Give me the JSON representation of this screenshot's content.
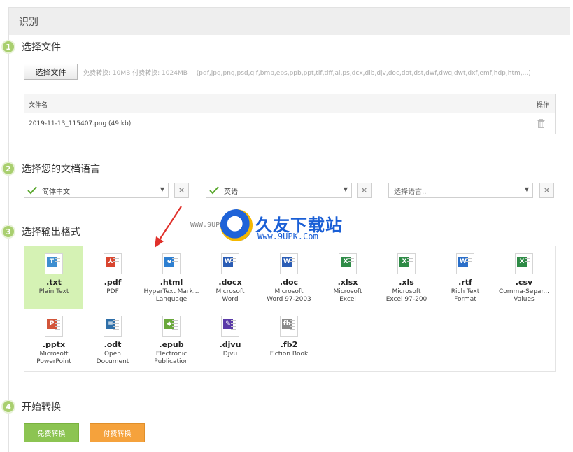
{
  "panel": {
    "title": "识别"
  },
  "steps": [
    {
      "num": "1",
      "title": "选择文件"
    },
    {
      "num": "2",
      "title": "选择您的文档语言"
    },
    {
      "num": "3",
      "title": "选择输出格式"
    },
    {
      "num": "4",
      "title": "开始转换"
    }
  ],
  "file": {
    "button_label": "选择文件",
    "limits": "免费转换: 10MB  付费转换: 1024MB",
    "formats": "(pdf,jpg,png,psd,gif,bmp,eps,ppb,ppt,tif,tiff,ai,ps,dcx,dib,djv,doc,dot,dst,dwf,dwg,dwt,dxf,emf,hdp,htm,...)",
    "table": {
      "col_name": "文件名",
      "col_action": "操作",
      "rows": [
        {
          "name": "2019-11-13_115407.png (49 kb)"
        }
      ]
    }
  },
  "languages": [
    {
      "value": "简体中文",
      "checked": true
    },
    {
      "value": "英语",
      "checked": true
    },
    {
      "value": "选择语言..",
      "checked": false
    }
  ],
  "formats": [
    {
      "ext": ".txt",
      "desc1": "Plain Text",
      "desc2": "",
      "badge": "T",
      "color": "#3e8ed0",
      "icon": "txt-file-icon",
      "selected": true
    },
    {
      "ext": ".pdf",
      "desc1": "PDF",
      "desc2": "",
      "badge": "⅄",
      "color": "#d9452f",
      "icon": "pdf-file-icon",
      "selected": false
    },
    {
      "ext": ".html",
      "desc1": "HyperText Mark...",
      "desc2": "Language",
      "badge": "e",
      "color": "#2d7fd1",
      "icon": "html-file-icon",
      "selected": false
    },
    {
      "ext": ".docx",
      "desc1": "Microsoft",
      "desc2": "Word",
      "badge": "W",
      "color": "#2b5db5",
      "icon": "docx-file-icon",
      "selected": false
    },
    {
      "ext": ".doc",
      "desc1": "Microsoft",
      "desc2": "Word 97-2003",
      "badge": "W",
      "color": "#2b5db5",
      "icon": "doc-file-icon",
      "selected": false
    },
    {
      "ext": ".xlsx",
      "desc1": "Microsoft",
      "desc2": "Excel",
      "badge": "X",
      "color": "#2e8b46",
      "icon": "xlsx-file-icon",
      "selected": false
    },
    {
      "ext": ".xls",
      "desc1": "Microsoft",
      "desc2": "Excel 97-200",
      "badge": "X",
      "color": "#2e8b46",
      "icon": "xls-file-icon",
      "selected": false
    },
    {
      "ext": ".rtf",
      "desc1": "Rich Text",
      "desc2": "Format",
      "badge": "W",
      "color": "#2b6fc9",
      "icon": "rtf-file-icon",
      "selected": false
    },
    {
      "ext": ".csv",
      "desc1": "Comma-Separ...",
      "desc2": "Values",
      "badge": "X",
      "color": "#2e8b46",
      "icon": "csv-file-icon",
      "selected": false
    },
    {
      "ext": ".pptx",
      "desc1": "Microsoft",
      "desc2": "PowerPoint",
      "badge": "P",
      "color": "#d2553a",
      "icon": "pptx-file-icon",
      "selected": false
    },
    {
      "ext": ".odt",
      "desc1": "Open",
      "desc2": "Document",
      "badge": "≡",
      "color": "#2f6fa8",
      "icon": "odt-file-icon",
      "selected": false
    },
    {
      "ext": ".epub",
      "desc1": "Electronic",
      "desc2": "Publication",
      "badge": "◆",
      "color": "#6aa83b",
      "icon": "epub-file-icon",
      "selected": false
    },
    {
      "ext": ".djvu",
      "desc1": "Djvu",
      "desc2": "",
      "badge": "✎",
      "color": "#5a3aa8",
      "icon": "djvu-file-icon",
      "selected": false
    },
    {
      "ext": ".fb2",
      "desc1": "Fiction Book",
      "desc2": "",
      "badge": "fb",
      "color": "#8a8a8a",
      "icon": "fb2-file-icon",
      "selected": false
    }
  ],
  "watermark": {
    "brand": "久友下载站",
    "site": "Www.9UPK.Com",
    "url": "WWW.9UPK.COM"
  },
  "convert": {
    "free_label": "免费转换",
    "paid_label": "付费转换"
  },
  "colors": {
    "accent_green": "#8cc452",
    "accent_orange": "#f5a23c",
    "selected_bg": "#d5f2b4",
    "step_badge": "#a9cf6f"
  }
}
